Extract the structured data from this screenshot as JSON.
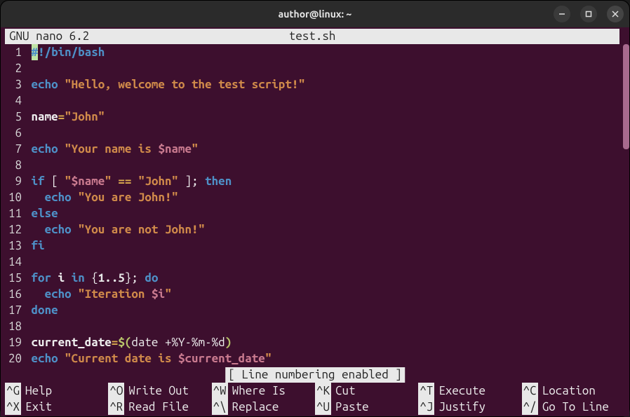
{
  "titlebar": "author@linux: ~",
  "header": {
    "app": "  GNU nano 6.2",
    "filename": "test.sh"
  },
  "lines": [
    {
      "n": "1",
      "segments": [
        {
          "t": "#",
          "cls": "kw cursorcell"
        },
        {
          "t": "!/bin/bash",
          "cls": "kw"
        }
      ]
    },
    {
      "n": "2",
      "segments": []
    },
    {
      "n": "3",
      "segments": [
        {
          "t": "echo",
          "cls": "kw"
        },
        {
          "t": " ",
          "cls": "plain"
        },
        {
          "t": "\"Hello, welcome to the test script!\"",
          "cls": "str"
        }
      ]
    },
    {
      "n": "4",
      "segments": []
    },
    {
      "n": "5",
      "segments": [
        {
          "t": "name",
          "cls": "var"
        },
        {
          "t": "=",
          "cls": "op"
        },
        {
          "t": "\"John\"",
          "cls": "str"
        }
      ]
    },
    {
      "n": "6",
      "segments": []
    },
    {
      "n": "7",
      "segments": [
        {
          "t": "echo",
          "cls": "kw"
        },
        {
          "t": " ",
          "cls": "plain"
        },
        {
          "t": "\"Your name is ",
          "cls": "str"
        },
        {
          "t": "$name",
          "cls": "strdim"
        },
        {
          "t": "\"",
          "cls": "str"
        }
      ]
    },
    {
      "n": "8",
      "segments": []
    },
    {
      "n": "9",
      "segments": [
        {
          "t": "if",
          "cls": "kw"
        },
        {
          "t": " [ ",
          "cls": "plain"
        },
        {
          "t": "\"",
          "cls": "str"
        },
        {
          "t": "$name",
          "cls": "strdim"
        },
        {
          "t": "\"",
          "cls": "str"
        },
        {
          "t": " ",
          "cls": "plain"
        },
        {
          "t": "==",
          "cls": "op"
        },
        {
          "t": " ",
          "cls": "plain"
        },
        {
          "t": "\"John\"",
          "cls": "str"
        },
        {
          "t": " ]; ",
          "cls": "plain"
        },
        {
          "t": "then",
          "cls": "kw"
        }
      ]
    },
    {
      "n": "10",
      "segments": [
        {
          "t": "  ",
          "cls": "plain"
        },
        {
          "t": "echo",
          "cls": "kw"
        },
        {
          "t": " ",
          "cls": "plain"
        },
        {
          "t": "\"You are John!\"",
          "cls": "str"
        }
      ]
    },
    {
      "n": "11",
      "segments": [
        {
          "t": "else",
          "cls": "kw"
        }
      ]
    },
    {
      "n": "12",
      "segments": [
        {
          "t": "  ",
          "cls": "plain"
        },
        {
          "t": "echo",
          "cls": "kw"
        },
        {
          "t": " ",
          "cls": "plain"
        },
        {
          "t": "\"You are not John!\"",
          "cls": "str"
        }
      ]
    },
    {
      "n": "13",
      "segments": [
        {
          "t": "fi",
          "cls": "kw"
        }
      ]
    },
    {
      "n": "14",
      "segments": []
    },
    {
      "n": "15",
      "segments": [
        {
          "t": "for",
          "cls": "kw"
        },
        {
          "t": " ",
          "cls": "plain"
        },
        {
          "t": "i",
          "cls": "var"
        },
        {
          "t": " ",
          "cls": "plain"
        },
        {
          "t": "in",
          "cls": "kw"
        },
        {
          "t": " {",
          "cls": "plain"
        },
        {
          "t": "1..5",
          "cls": "num"
        },
        {
          "t": "}; ",
          "cls": "plain"
        },
        {
          "t": "do",
          "cls": "kw"
        }
      ]
    },
    {
      "n": "16",
      "segments": [
        {
          "t": "  ",
          "cls": "plain"
        },
        {
          "t": "echo",
          "cls": "kw"
        },
        {
          "t": " ",
          "cls": "plain"
        },
        {
          "t": "\"Iteration ",
          "cls": "str"
        },
        {
          "t": "$i",
          "cls": "strdim"
        },
        {
          "t": "\"",
          "cls": "str"
        }
      ]
    },
    {
      "n": "17",
      "segments": [
        {
          "t": "done",
          "cls": "kw"
        }
      ]
    },
    {
      "n": "18",
      "segments": []
    },
    {
      "n": "19",
      "segments": [
        {
          "t": "current_date",
          "cls": "var"
        },
        {
          "t": "=",
          "cls": "op"
        },
        {
          "t": "$(",
          "cls": "cmdsub"
        },
        {
          "t": "date +%Y-%m-%d",
          "cls": "plain"
        },
        {
          "t": ")",
          "cls": "cmdsub"
        }
      ]
    },
    {
      "n": "20",
      "segments": [
        {
          "t": "echo",
          "cls": "kw"
        },
        {
          "t": " ",
          "cls": "plain"
        },
        {
          "t": "\"Current date is ",
          "cls": "str"
        },
        {
          "t": "$current_date",
          "cls": "strdim"
        },
        {
          "t": "\"",
          "cls": "str"
        }
      ]
    }
  ],
  "status_message": "[ Line numbering enabled ]",
  "shortcuts_row1": [
    {
      "key": "^G",
      "label": "Help"
    },
    {
      "key": "^O",
      "label": "Write Out"
    },
    {
      "key": "^W",
      "label": "Where Is"
    },
    {
      "key": "^K",
      "label": "Cut"
    },
    {
      "key": "^T",
      "label": "Execute"
    },
    {
      "key": "^C",
      "label": "Location"
    }
  ],
  "shortcuts_row2": [
    {
      "key": "^X",
      "label": "Exit"
    },
    {
      "key": "^R",
      "label": "Read File"
    },
    {
      "key": "^\\",
      "label": "Replace"
    },
    {
      "key": "^U",
      "label": "Paste"
    },
    {
      "key": "^J",
      "label": "Justify"
    },
    {
      "key": "^/",
      "label": "Go To Line"
    }
  ]
}
